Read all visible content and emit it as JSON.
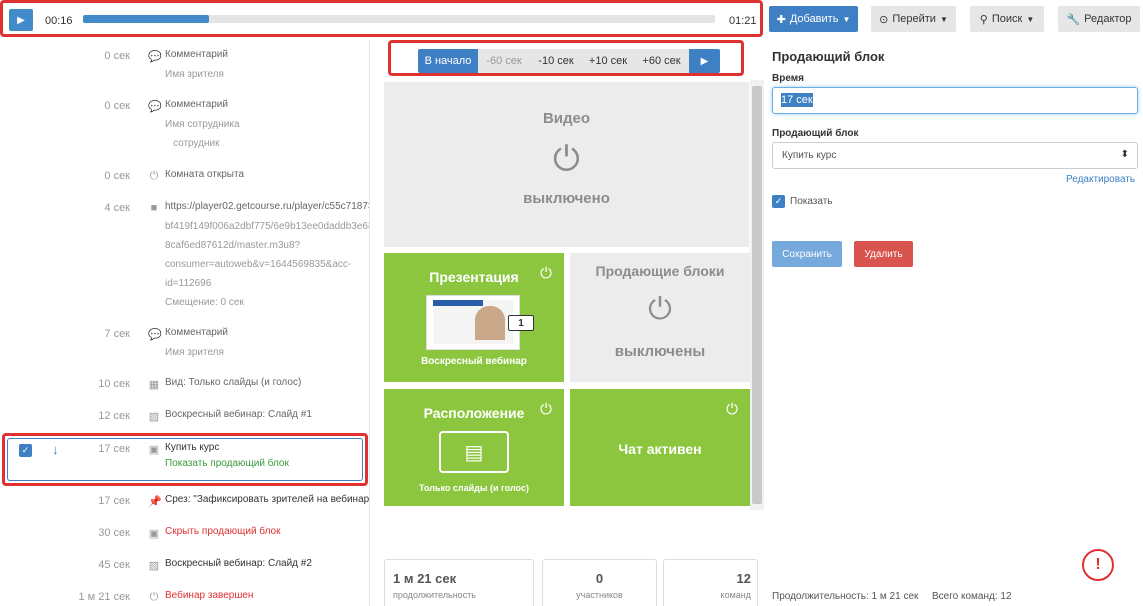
{
  "player": {
    "play_icon": "play-icon",
    "current_time": "00:16",
    "total_time": "01:21",
    "progress": 0.2
  },
  "toolbar": {
    "add_label": "Добавить",
    "goto_label": "Перейти",
    "search_label": "Поиск",
    "editor_label": "Редактор",
    "accent_color": "#3f80c5"
  },
  "log": {
    "events": [
      {
        "time": "0 сек",
        "icon": "comment-icon",
        "label": "Комментарий",
        "sub": [
          "Имя зрителя"
        ]
      },
      {
        "time": "0 сек",
        "icon": "comment-icon",
        "label": "Комментарий",
        "sub": [
          "Имя сотрудника",
          "сотрудник"
        ]
      },
      {
        "time": "0 сек",
        "icon": "power-icon",
        "label": "Комната открыта",
        "sub": []
      },
      {
        "time": "4 сек",
        "icon": "video-camera-icon",
        "label": "https://player02.getcourse.ru/player/c55c71873a0",
        "sub": [
          "bf419f149f006a2dbf775/6e9b13ee0daddb3e685",
          "8caf6ed87612d/master.m3u8?",
          "consumer=autoweb&v=1644569835&acc-",
          "id=112696",
          "Смещение: 0 сек"
        ]
      },
      {
        "time": "7 сек",
        "icon": "comment-icon",
        "label": "Комментарий",
        "sub": [
          "Имя зрителя"
        ]
      },
      {
        "time": "10 сек",
        "icon": "grid-icon",
        "label": "Вид: Только слайды (и голос)",
        "sub": []
      },
      {
        "time": "12 сек",
        "icon": "image-icon",
        "label": "Воскресный вебинар: Слайд #1",
        "sub": []
      },
      {
        "time": "17 сек",
        "icon": "money-icon",
        "label": "Купить курс",
        "sub": [
          "Показать продающий блок"
        ],
        "selected": true
      },
      {
        "time": "17 сек",
        "icon": "pin-icon",
        "label": "Срез: \"Зафиксировать зрителей на вебинаре\"",
        "sub": []
      },
      {
        "time": "30 сек",
        "icon": "money-icon",
        "label": "Скрыть продающий блок",
        "sub": []
      },
      {
        "time": "45 сек",
        "icon": "image-icon",
        "label": "Воскресный вебинар: Слайд #2",
        "sub": []
      },
      {
        "time": "1 м 21 сек",
        "icon": "power-icon",
        "label": "Вебинар завершен",
        "sub": []
      }
    ]
  },
  "nav": {
    "start": "В начало",
    "m60": "-60 сек",
    "m10": "-10 сек",
    "p10": "+10 сек",
    "p60": "+60 сек"
  },
  "cards": {
    "video": {
      "title": "Видео",
      "state": "выключено"
    },
    "presentation": {
      "title": "Презентация",
      "slide_number": "1",
      "name": "Воскресный вебинар"
    },
    "sales": {
      "title": "Продающие блоки",
      "state": "выключены"
    },
    "layout": {
      "title": "Расположение",
      "name": "Только слайды (и голос)"
    },
    "chat": {
      "title": "Чат активен"
    }
  },
  "stats": [
    {
      "value": "1 м 21 сек",
      "key": "продолжительность"
    },
    {
      "value": "0",
      "key": "участников"
    },
    {
      "value": "12",
      "key": "команд"
    }
  ],
  "panel": {
    "title": "Продающий блок",
    "time_label": "Время",
    "time_value": "17 сек",
    "block_label": "Продающий блок",
    "block_value": "Купить курс",
    "edit_link": "Редактировать",
    "show_label": "Показать",
    "save": "Сохранить",
    "delete": "Удалить",
    "alert": "!",
    "duration": "Продолжительность: 1 м 21 сек",
    "commands": "Всего команд: 12"
  }
}
